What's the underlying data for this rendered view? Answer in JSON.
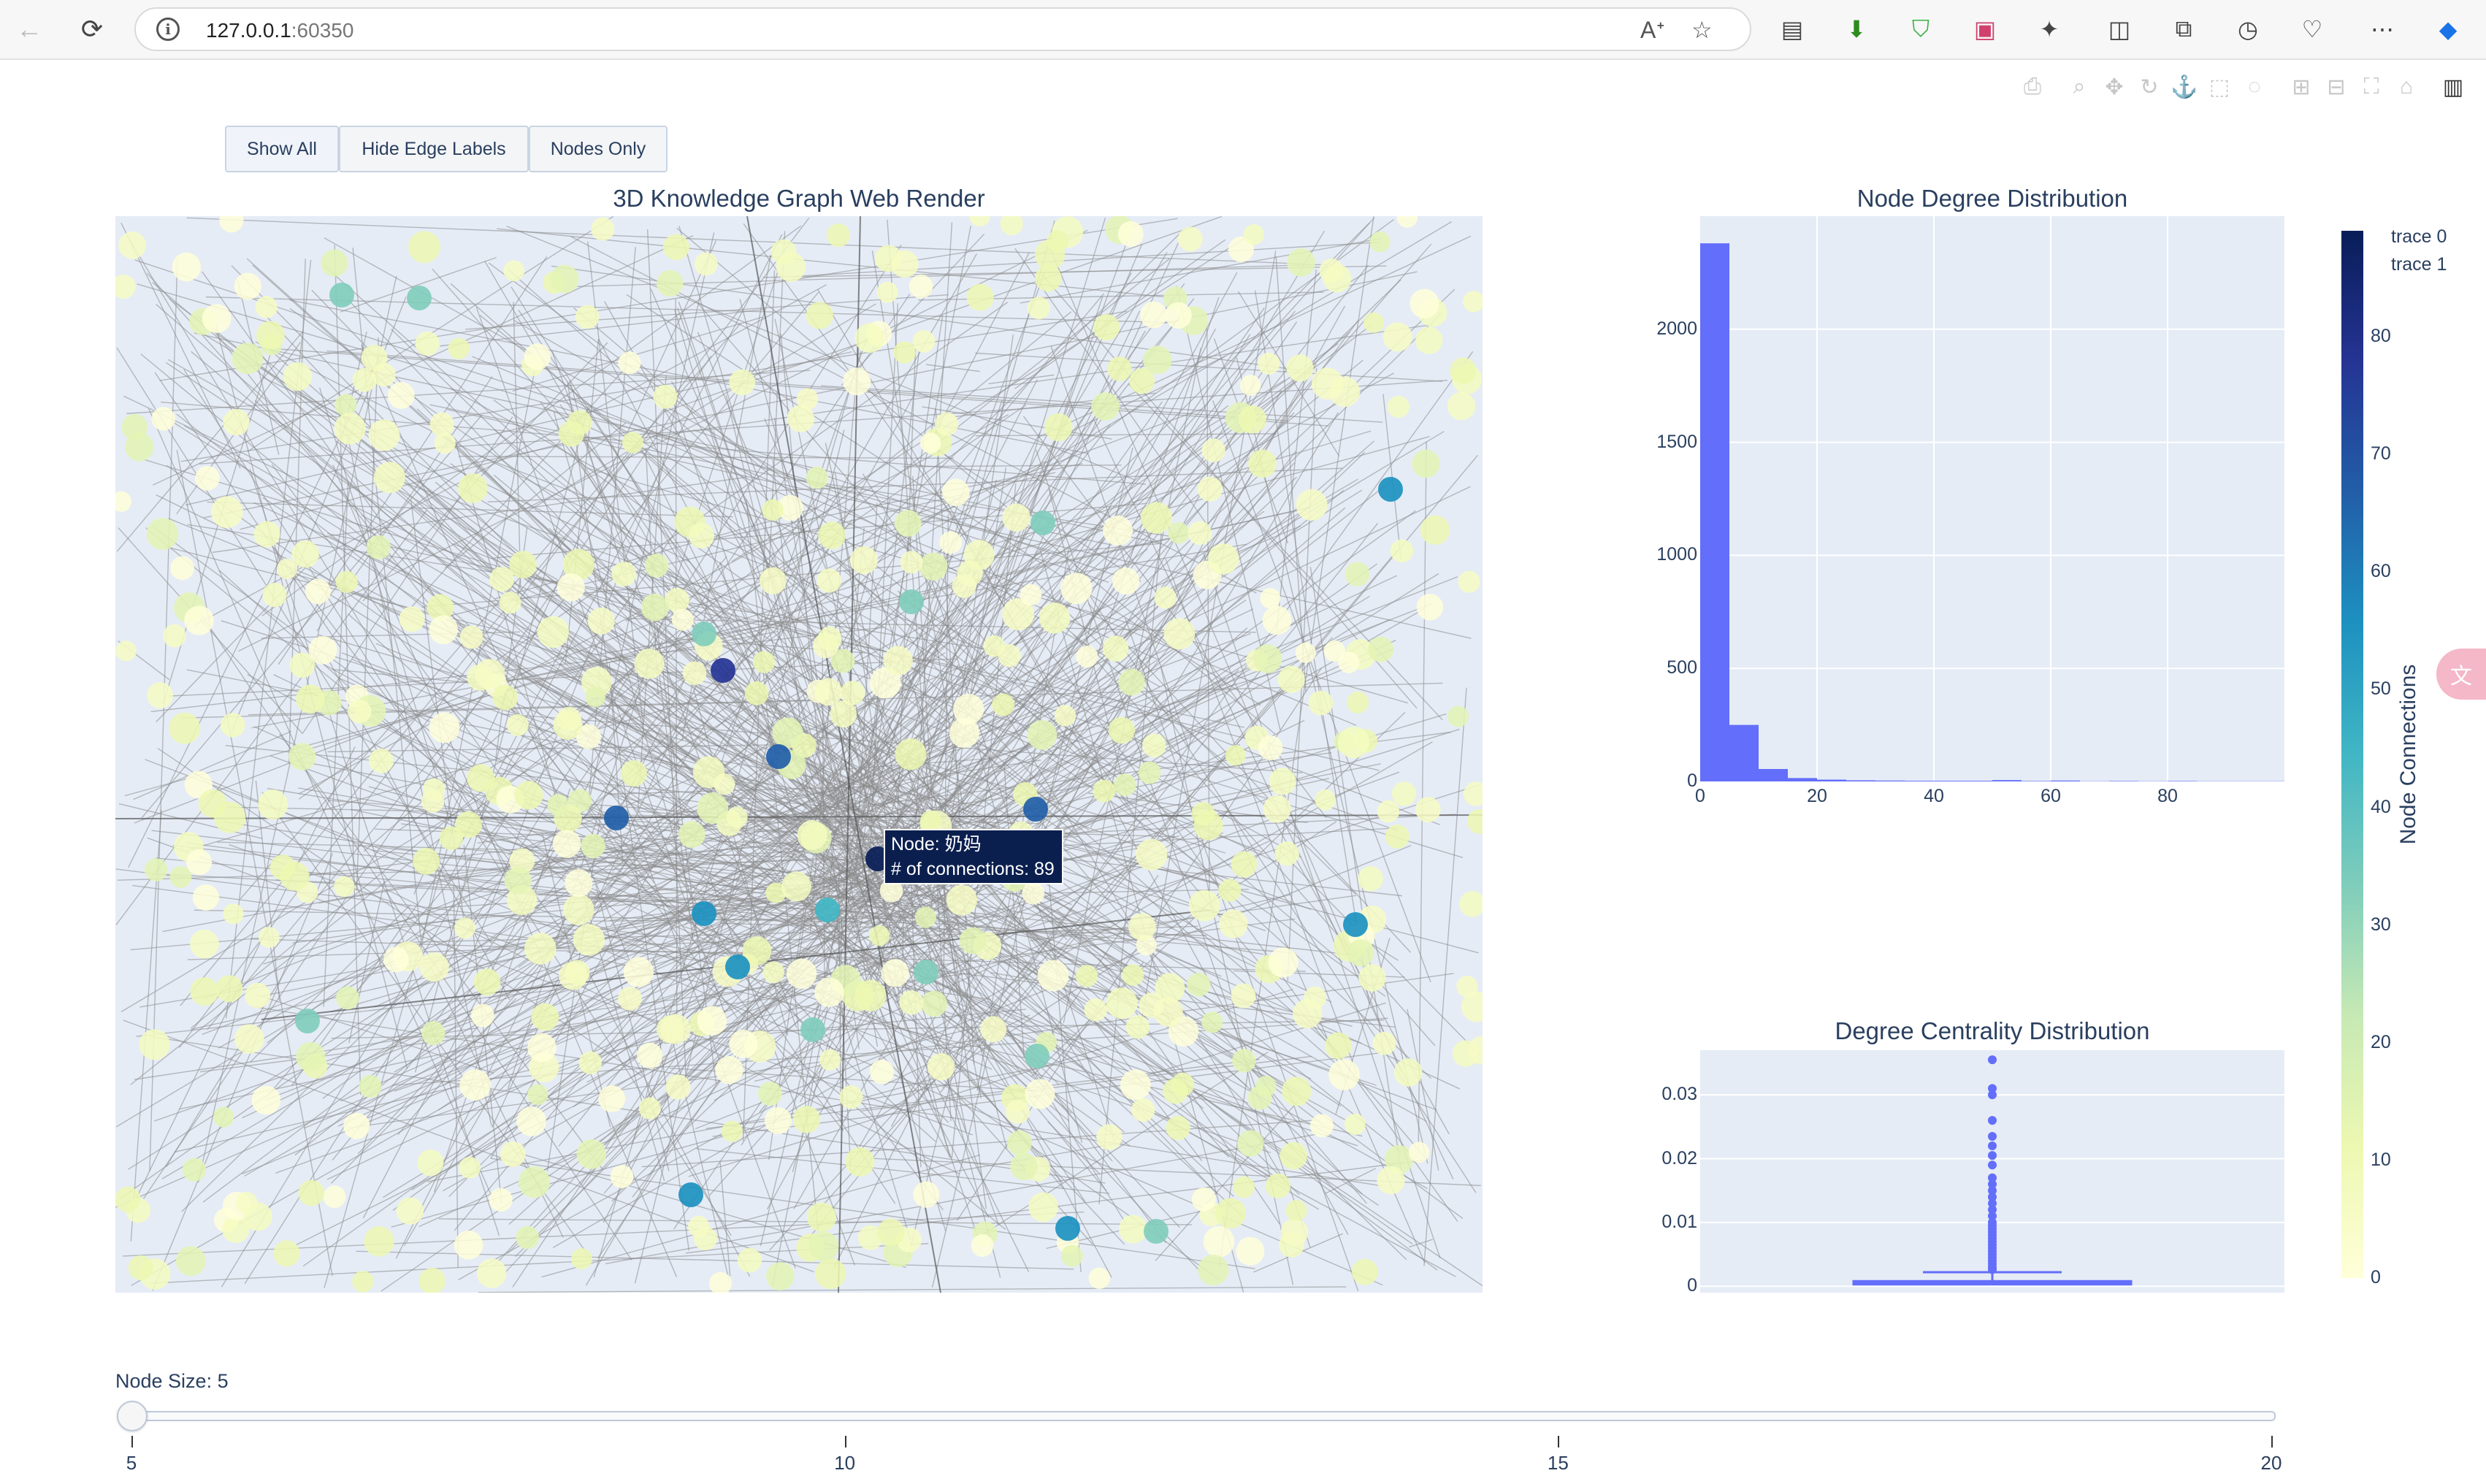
{
  "browser": {
    "url_host": "127.0.0.1",
    "url_port": ":60350"
  },
  "buttons": {
    "show_all": "Show All",
    "hide_edge_labels": "Hide Edge Labels",
    "nodes_only": "Nodes Only"
  },
  "graph": {
    "title": "3D Knowledge Graph Web Render",
    "tooltip_node": "Node: 奶妈",
    "tooltip_connections": "# of connections: 89"
  },
  "histogram": {
    "title": "Node Degree Distribution"
  },
  "boxplot": {
    "title": "Degree Centrality Distribution"
  },
  "colorbar": {
    "title": "Node Connections",
    "ticks": [
      "80",
      "70",
      "60",
      "50",
      "40",
      "30",
      "20",
      "10",
      "0"
    ],
    "colorscale": [
      "#ffffd9",
      "#edf8b1",
      "#c7e9b4",
      "#7fcdbb",
      "#41b6c4",
      "#1d91c0",
      "#225ea8",
      "#253494",
      "#081d58"
    ]
  },
  "legend": {
    "items": [
      "trace 0",
      "trace 1"
    ]
  },
  "slider": {
    "label": "Node Size: 5",
    "ticks": [
      "5",
      "10",
      "15",
      "20"
    ],
    "value": 5,
    "min": 5,
    "max": 20
  },
  "chart_data": [
    {
      "type": "bar",
      "title": "Node Degree Distribution",
      "bin_starts": [
        0,
        5,
        10,
        15,
        20,
        25,
        30,
        35,
        40,
        45,
        50,
        55,
        60,
        65,
        70,
        75,
        80,
        85,
        90,
        95
      ],
      "values": [
        2380,
        250,
        55,
        15,
        8,
        5,
        4,
        3,
        3,
        3,
        6,
        2,
        4,
        1,
        2,
        1,
        2,
        1,
        1,
        1
      ],
      "x_ticks": [
        "0",
        "20",
        "40",
        "60",
        "80"
      ],
      "y_ticks": [
        "0",
        "500",
        "1000",
        "1500",
        "2000"
      ],
      "xlim": [
        0,
        100
      ],
      "ylim": [
        0,
        2500
      ],
      "color": "#636efa"
    },
    {
      "type": "box",
      "title": "Degree Centrality Distribution",
      "median": 0.0005,
      "q1": 0.0003,
      "q3": 0.0008,
      "whisker_low": 0,
      "whisker_high": 0.0022,
      "outliers": [
        0.0026,
        0.003,
        0.0035,
        0.004,
        0.0045,
        0.005,
        0.0055,
        0.006,
        0.0065,
        0.007,
        0.0075,
        0.008,
        0.0085,
        0.009,
        0.0095,
        0.01,
        0.011,
        0.012,
        0.013,
        0.014,
        0.015,
        0.016,
        0.017,
        0.019,
        0.0205,
        0.022,
        0.0235,
        0.026,
        0.03,
        0.031,
        0.0355
      ],
      "y_ticks": [
        "0",
        "0.01",
        "0.02",
        "0.03"
      ],
      "ylim": [
        -0.001,
        0.037
      ],
      "color": "#636efa"
    }
  ]
}
